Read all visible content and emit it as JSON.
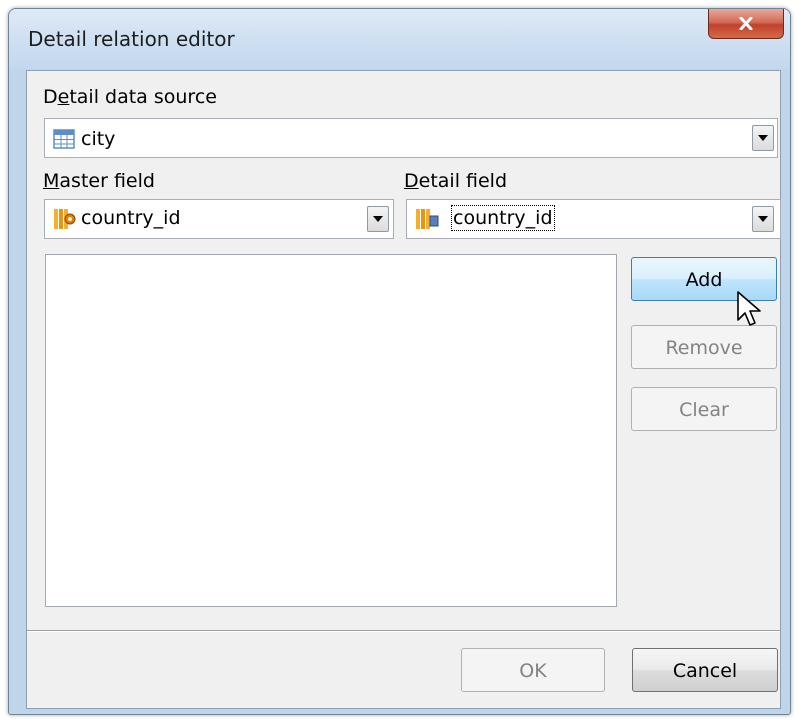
{
  "window": {
    "title": "Detail relation editor"
  },
  "detail_data_source": {
    "label_prefix": "D",
    "label_access": "e",
    "label_rest": "tail data source",
    "value": "city",
    "icon": "table-icon"
  },
  "master_field": {
    "label_access": "M",
    "label_rest": "aster field",
    "value": "country_id",
    "icon": "key-field-icon"
  },
  "detail_field": {
    "label_access": "D",
    "label_rest": "etail field",
    "value": "country_id",
    "icon": "field-icon"
  },
  "side_buttons": {
    "add": "Add",
    "remove": "Remove",
    "clear": "Clear"
  },
  "footer_buttons": {
    "ok": "OK",
    "cancel": "Cancel"
  },
  "colors": {
    "accent": "#3c7fb1",
    "close_red": "#c0412a"
  }
}
